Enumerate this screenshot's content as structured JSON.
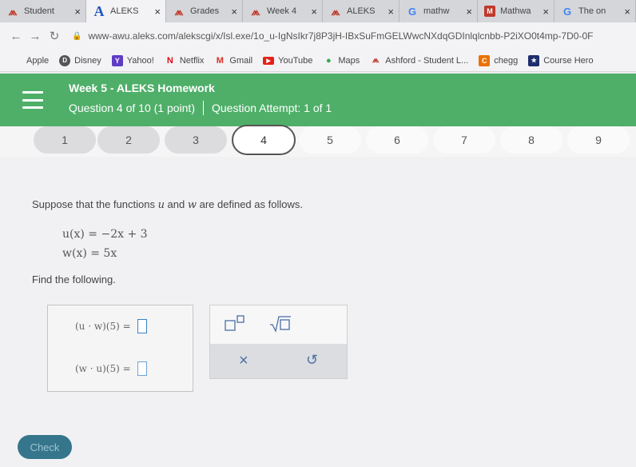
{
  "tabs": [
    {
      "title": "Student",
      "favicon": "ashford-icon",
      "close": "×"
    },
    {
      "title": "ALEKS",
      "favicon": "aleks-icon",
      "close": "×"
    },
    {
      "title": "Grades",
      "favicon": "ashford-icon",
      "close": "×"
    },
    {
      "title": "Week 4",
      "favicon": "ashford-icon",
      "close": "×"
    },
    {
      "title": "ALEKS",
      "favicon": "ashford-icon",
      "close": "×"
    },
    {
      "title": "mathw",
      "favicon": "google-icon",
      "close": "×"
    },
    {
      "title": "Mathwa",
      "favicon": "mathway-icon",
      "close": "×"
    },
    {
      "title": "The on",
      "favicon": "google-icon",
      "close": "×"
    }
  ],
  "nav": {
    "url": "www-awu.aleks.com/alekscgi/x/Isl.exe/1o_u-IgNsIkr7j8P3jH-IBxSuFmGELWwcNXdqGDInlqlcnbb-P2iXO0t4mp-7D0-0F"
  },
  "bookmarks": [
    {
      "label": "Apple",
      "icon": "apple-icon"
    },
    {
      "label": "Disney",
      "icon": "disney-icon"
    },
    {
      "label": "Yahoo!",
      "icon": "yahoo-icon"
    },
    {
      "label": "Netflix",
      "icon": "netflix-icon"
    },
    {
      "label": "Gmail",
      "icon": "gmail-icon"
    },
    {
      "label": "YouTube",
      "icon": "youtube-icon"
    },
    {
      "label": "Maps",
      "icon": "maps-icon"
    },
    {
      "label": "Ashford - Student L...",
      "icon": "ashford-icon"
    },
    {
      "label": "chegg",
      "icon": "chegg-icon"
    },
    {
      "label": "Course Hero",
      "icon": "coursehero-icon"
    }
  ],
  "header": {
    "title": "Week 5 - ALEKS Homework",
    "question": "Question 4 of 10 (1 point)",
    "attempt": "Question Attempt: 1 of 1",
    "color": "#4faf69"
  },
  "question_nav": {
    "items": [
      "1",
      "2",
      "3",
      "4",
      "5",
      "6",
      "7",
      "8",
      "9"
    ],
    "current": "4"
  },
  "problem": {
    "prompt_parts": [
      "Suppose that the functions ",
      "u",
      " and ",
      "w",
      " are defined as follows."
    ],
    "u_def": "u(x) = −2x + 3",
    "w_def": "w(x) = 5x",
    "find": "Find the following."
  },
  "answers": {
    "row1_label": "(u · w)(5) =",
    "row2_label": "(w · u)(5) ="
  },
  "tools": {
    "clear": "×",
    "undo": "↺"
  },
  "check_label": "Check"
}
